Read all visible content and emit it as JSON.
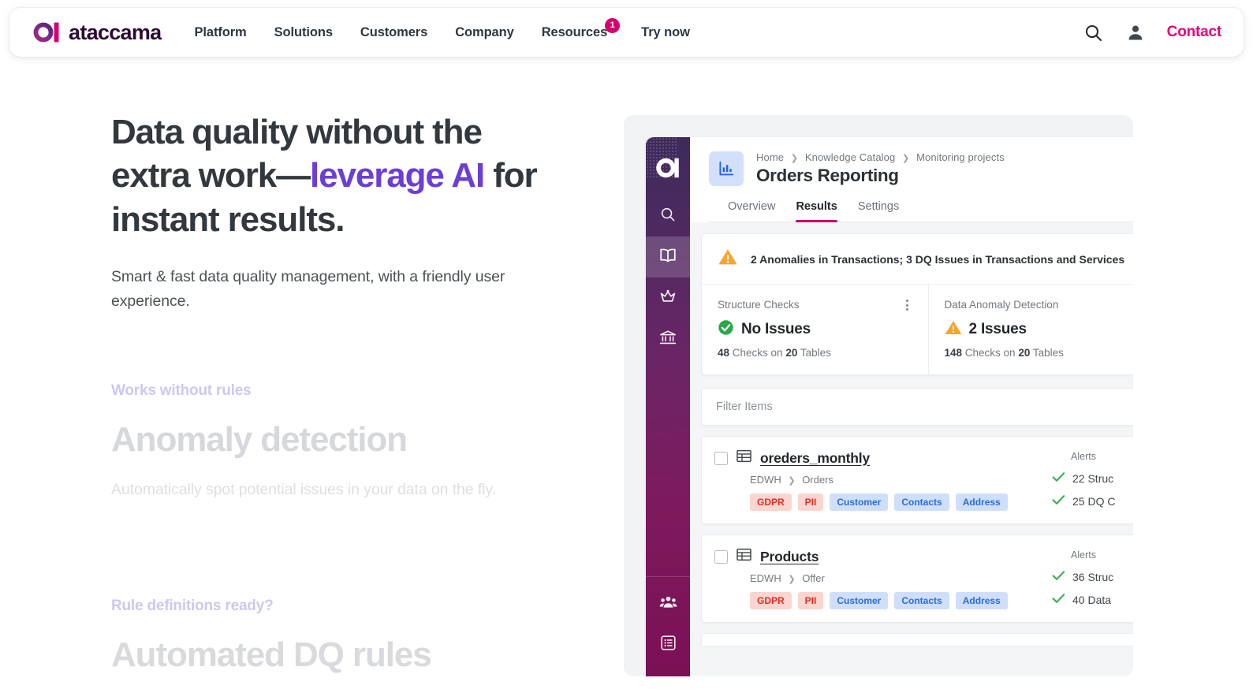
{
  "nav": {
    "brand": "ataccama",
    "links": [
      {
        "label": "Platform",
        "badge": null
      },
      {
        "label": "Solutions",
        "badge": null
      },
      {
        "label": "Customers",
        "badge": null
      },
      {
        "label": "Company",
        "badge": null
      },
      {
        "label": "Resources",
        "badge": "1"
      },
      {
        "label": "Try now",
        "badge": null
      }
    ],
    "search_icon": "search-icon",
    "account_icon": "user-account-icon",
    "contact": "Contact"
  },
  "hero": {
    "title_part1": "Data quality without the extra work—",
    "title_accent": "leverage AI",
    "title_part2": " for instant results.",
    "subtitle": "Smart & fast data quality management, with a friendly user experience."
  },
  "features": [
    {
      "eyebrow": "Works without rules",
      "title": "Anomaly detection",
      "description": "Automatically spot potential issues in your data on the fly."
    },
    {
      "eyebrow": "Rule definitions ready?",
      "title": "Automated DQ rules",
      "description": ""
    }
  ],
  "app": {
    "sidebar": {
      "logo": "ataccama-mark-icon",
      "items": [
        {
          "name": "search-icon",
          "active": false
        },
        {
          "name": "book-catalog-icon",
          "active": true
        },
        {
          "name": "crown-icon",
          "active": false
        },
        {
          "name": "bank-governance-icon",
          "active": false
        }
      ],
      "bottom_items": [
        {
          "name": "people-group-icon"
        },
        {
          "name": "list-tasks-icon"
        }
      ]
    },
    "header": {
      "project_icon": "bar-chart-icon",
      "breadcrumb": [
        "Home",
        "Knowledge Catalog",
        "Monitoring projects"
      ],
      "title": "Orders Reporting"
    },
    "tabs": [
      {
        "label": "Overview",
        "active": false
      },
      {
        "label": "Results",
        "active": true
      },
      {
        "label": "Settings",
        "active": false
      }
    ],
    "alert": {
      "icon": "warning-triangle-icon",
      "text": "2 Anomalies in Transactions; 3 DQ Issues in Transactions and Services"
    },
    "stats": [
      {
        "label": "Structure Checks",
        "status_icon": "check-circle-icon",
        "status_text": "No Issues",
        "sub_count": "48",
        "sub_mid": " Checks on ",
        "sub_count2": "20",
        "sub_end": " Tables",
        "has_kebab": true
      },
      {
        "label": "Data Anomaly Detection",
        "status_icon": "warning-triangle-icon",
        "status_text": "2 Issues",
        "sub_count": "148",
        "sub_mid": " Checks on ",
        "sub_count2": "20",
        "sub_end": " Tables",
        "has_kebab": false
      }
    ],
    "filter": {
      "placeholder": "Filter Items",
      "value": ""
    },
    "rows": [
      {
        "checkbox_icon": "checkbox-unchecked-icon",
        "table_icon": "table-icon",
        "name": "oreders_monthly",
        "path_root": "EDWH",
        "path_leaf": "Orders",
        "tags": [
          {
            "label": "GDPR",
            "color": "red"
          },
          {
            "label": "PII",
            "color": "red"
          },
          {
            "label": "Customer",
            "color": "blue"
          },
          {
            "label": "Contacts",
            "color": "blue"
          },
          {
            "label": "Address",
            "color": "blue"
          }
        ],
        "alerts_label": "Alerts",
        "alerts": [
          {
            "icon": "check-icon",
            "text": "22 Struc"
          },
          {
            "icon": "check-icon",
            "text": "25 DQ C"
          }
        ]
      },
      {
        "checkbox_icon": "checkbox-unchecked-icon",
        "table_icon": "table-icon",
        "name": "Products",
        "path_root": "EDWH",
        "path_leaf": "Offer",
        "tags": [
          {
            "label": "GDPR",
            "color": "red"
          },
          {
            "label": "PII",
            "color": "red"
          },
          {
            "label": "Customer",
            "color": "blue"
          },
          {
            "label": "Contacts",
            "color": "blue"
          },
          {
            "label": "Address",
            "color": "blue"
          }
        ],
        "alerts_label": "Alerts",
        "alerts": [
          {
            "icon": "check-icon",
            "text": "36 Struc"
          },
          {
            "icon": "check-icon",
            "text": "40 Data"
          }
        ]
      }
    ]
  },
  "colors": {
    "brand_pink": "#e5007d",
    "accent_purple": "#6b3fd4",
    "warning_orange": "#f5a530",
    "success_green": "#2aa84a",
    "tab_underline": "#c7006b"
  }
}
